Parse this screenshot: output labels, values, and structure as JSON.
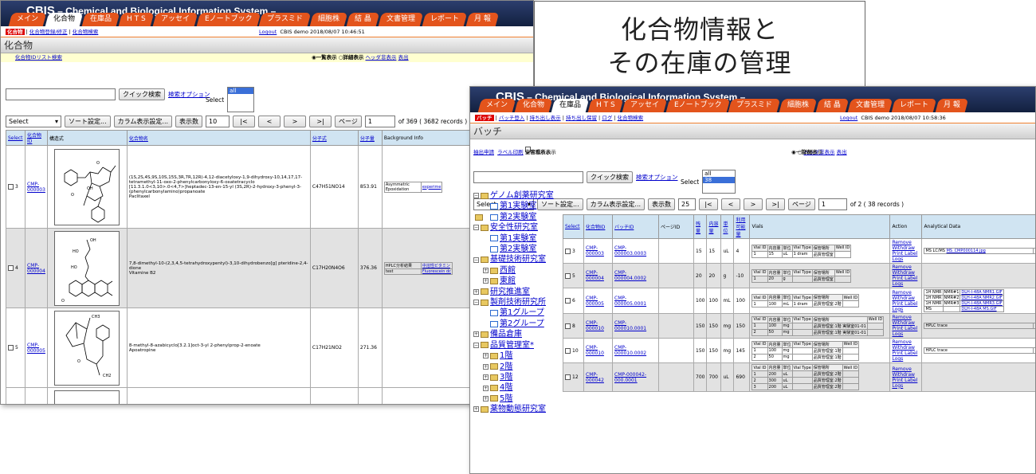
{
  "app": {
    "brand_bold": "CBIS",
    "brand_rest": " – Chemical and Biological Information System –"
  },
  "tabs": [
    "メイン",
    "化合物",
    "在庫品",
    "H T S",
    "アッセイ",
    "Eノートブック",
    "プラスミド",
    "細胞株",
    "結 晶",
    "文書管理",
    "レポート",
    "月 報"
  ],
  "w1": {
    "sub": {
      "current": "化合物",
      "links": [
        "化合物登録/修正",
        "化合物検索"
      ],
      "logout": "Logout",
      "user": "CBIS demo  2018/08/07 10:46:51"
    },
    "page_title": "化合物",
    "list_link": "化合物IDリスト検索",
    "radio_list": "一覧表示",
    "radio_detail": "詳細表示",
    "hide_header": "ヘッダ非表示",
    "output": "表出",
    "quick_search": "クイック検索",
    "search_option": "検索オプション",
    "select_label": "Select",
    "select_option": "all",
    "select_box": "Select",
    "sort": "ソート設定...",
    "column": "カラム表示設定...",
    "count_label": "表示数",
    "count": "10",
    "nav": [
      "|<",
      "<",
      ">",
      ">|"
    ],
    "page_label": "ページ",
    "page": "1",
    "records": "of 369 ( 3682 records )",
    "headers": [
      "Select",
      "化合物ID",
      "構造式",
      "化合物名",
      "分子式",
      "分子量",
      "Background Info"
    ],
    "rows": [
      {
        "n": "3",
        "id": "CMP-000003",
        "name": "(1S,2S,4S,9S,10S,15S,3R,7R,12R)-4,12-diacetyloxy-1,9-dihydroxy-10,14,17,17-tetramethyl-11-oxo-2-phenylcarbonyloxy-6-oxatetracyclo [11.3.1.0<3,10>.0<4,7>]heptadec-13-en-15-yl (3S,2R)-2-hydroxy-3-phenyl-3-(phenylcarbonylamino)propanoate\nPaclitaxel",
        "formula": "C47H51NO14",
        "mw": "853.91",
        "bg1": "Asymmetric Epoxidation",
        "bg2": "experime"
      },
      {
        "n": "4",
        "id": "CMP-000004",
        "name": "7,8-dimethyl-10-(2,3,4,5-tetrahydroxypentyl)-3,10-dihydrobenzo[g] pteridine-2,4-dione\nVitamine B2",
        "formula": "C17H20N4O6",
        "mw": "376.36",
        "bg1": "HPLC分析結果",
        "bg2": "中溶性ビタミン",
        "bg3": "test",
        "bg4": "Fluorescein dc"
      },
      {
        "n": "5",
        "id": "CMP-000005",
        "name": "8-methyl-8-azabicyclo[3.2.1]oct-3-yl 2-phenylprop-2-enoate\nApoatropine",
        "formula": "C17H21NO2",
        "mw": "271.36"
      }
    ]
  },
  "callout": {
    "line1": "化合物情報と",
    "line2": "その在庫の管理"
  },
  "w2": {
    "sub": {
      "current": "バッチ",
      "links": [
        "バッチ登入",
        "持ち出し表示",
        "持ち出し保留",
        "ログ",
        "化合物検索"
      ],
      "logout": "Logout",
      "user": "CBIS demo  2018/08/07 10:58:36"
    },
    "page_title": "バッチ",
    "bar_links": [
      "抽出申請",
      "ラベル印刷"
    ],
    "chk1": "保管場所表示",
    "chk2": "空容器表示",
    "radio_list": "一覧表示",
    "radio_detail": "詳細表示",
    "hide_header": "ヘッダ非表示",
    "output": "表出",
    "quick_search": "クイック検索",
    "search_option": "検索オプション",
    "select_label": "Select",
    "select_options": [
      "all",
      "38"
    ],
    "select_box": "Select",
    "sort": "ソート設定...",
    "column": "カラム表示設定...",
    "count_label": "表示数",
    "count": "25",
    "nav": [
      "|<",
      "<",
      ">",
      ">|"
    ],
    "page_label": "ページ",
    "page": "1",
    "records": "of 2 ( 38 records )",
    "tree": [
      {
        "t": "ゲノム創薬研究室",
        "d": 0,
        "pm": "⊟",
        "type": "folder"
      },
      {
        "t": "第1実験室",
        "d": 1,
        "type": "doc"
      },
      {
        "t": "第2実験室",
        "d": 1,
        "type": "doc"
      },
      {
        "t": "安全性研究室",
        "d": 0,
        "pm": "⊟",
        "type": "folder"
      },
      {
        "t": "第1実験室",
        "d": 1,
        "type": "doc"
      },
      {
        "t": "第2実験室",
        "d": 1,
        "type": "doc"
      },
      {
        "t": "基礎技術研究室",
        "d": 0,
        "pm": "⊟",
        "type": "folder"
      },
      {
        "t": "西館",
        "d": 1,
        "pm": "⊞",
        "type": "folder"
      },
      {
        "t": "東館",
        "d": 1,
        "pm": "⊞",
        "type": "folder"
      },
      {
        "t": "研究推進室",
        "d": 0,
        "pm": "⊞",
        "type": "folder"
      },
      {
        "t": "製剤技術研究所",
        "d": 0,
        "pm": "⊟",
        "type": "folder"
      },
      {
        "t": "第1グループ",
        "d": 1,
        "type": "doc"
      },
      {
        "t": "第2グループ",
        "d": 1,
        "type": "doc"
      },
      {
        "t": "備品倉庫",
        "d": 0,
        "pm": "⊞",
        "type": "folder"
      },
      {
        "t": "品質管理室*",
        "d": 0,
        "pm": "⊟",
        "type": "folder"
      },
      {
        "t": "1階",
        "d": 1,
        "pm": "⊞",
        "type": "folder"
      },
      {
        "t": "2階",
        "d": 1,
        "pm": "⊞",
        "type": "folder"
      },
      {
        "t": "3階",
        "d": 1,
        "pm": "⊞",
        "type": "folder"
      },
      {
        "t": "4階",
        "d": 1,
        "pm": "⊞",
        "type": "folder"
      },
      {
        "t": "5階",
        "d": 1,
        "pm": "⊞",
        "type": "folder"
      },
      {
        "t": "薬物動態研究室",
        "d": 0,
        "pm": "⊞",
        "type": "folder"
      }
    ],
    "headers": [
      "Select",
      "化合物ID",
      "バッチID",
      "ページID",
      "残量",
      "内容量",
      "単位",
      "利用可能量",
      "Vials",
      "Action",
      "Analytical Data"
    ],
    "vial_headers": [
      "Vial ID",
      "内容量",
      "単位",
      "Vial Type",
      "保管場所",
      "Well ID"
    ],
    "actions": [
      "Remove",
      "Withdraw",
      "Print Label",
      "Logs"
    ],
    "rows": [
      {
        "n": "3",
        "cid": "CMP-000003",
        "bid": "CMP-000003.0003",
        "rem": "15",
        "cont": "15",
        "unit": "uL",
        "avail": "4",
        "vials": [
          [
            "1",
            "15",
            "uL",
            "1 dram",
            "品質管理室",
            ""
          ]
        ],
        "ad": "MS LC/MS",
        "ad_link": "MS_CMP000114.jpg"
      },
      {
        "n": "5",
        "cid": "CMP-000004",
        "bid": "CMP-000004.0002",
        "rem": "20",
        "cont": "20",
        "unit": "g",
        "avail": "-10",
        "vials": [
          [
            "1",
            "20",
            "g",
            "",
            "品質管理室",
            ""
          ]
        ]
      },
      {
        "n": "6",
        "cid": "CMP-000005",
        "bid": "CMP-000005.0001",
        "rem": "100",
        "cont": "100",
        "unit": "mL",
        "avail": "100",
        "vials": [
          [
            "1",
            "100",
            "mL",
            "1 dram",
            "品質管理室:2階",
            ""
          ]
        ],
        "nmr": [
          [
            "1H NMR",
            "NMR#1",
            "DLH-I-48A NMR1.GIF"
          ],
          [
            "1H NMR",
            "NMR#2",
            "DLH-I-48A NMR2.GIF"
          ],
          [
            "1H NMR",
            "NMR#3",
            "DLH-I-48A NMR3.GIF"
          ],
          [
            "MS",
            "",
            "DLH-I-48A MS.GIF"
          ]
        ]
      },
      {
        "n": "8",
        "cid": "CMP-000010",
        "bid": "CMP-000010.0001",
        "rem": "150",
        "cont": "150",
        "unit": "mg",
        "avail": "150",
        "vials": [
          [
            "1",
            "100",
            "mg",
            "",
            "品質管理室:1階 実験室01-01",
            ""
          ],
          [
            "2",
            "50",
            "mg",
            "",
            "品質管理室:1階 実験室01-01",
            ""
          ]
        ],
        "ad": "HPLC trace"
      },
      {
        "n": "10",
        "cid": "CMP-000010",
        "bid": "CMP-000010.0002",
        "rem": "150",
        "cont": "150",
        "unit": "mg",
        "avail": "145",
        "vials": [
          [
            "1",
            "100",
            "mg",
            "",
            "品質管理室:1階",
            ""
          ],
          [
            "2",
            "50",
            "mg",
            "",
            "品質管理室:1階",
            ""
          ]
        ],
        "ad": "HPLC trace"
      },
      {
        "n": "12",
        "cid": "CMP-000042",
        "bid": "CMP-000042-000.0001",
        "rem": "700",
        "cont": "700",
        "unit": "uL",
        "avail": "690",
        "vials": [
          [
            "1",
            "200",
            "uL",
            "",
            "品質管理室:2階",
            ""
          ],
          [
            "2",
            "300",
            "uL",
            "",
            "品質管理室:2階",
            ""
          ],
          [
            "3",
            "200",
            "uL",
            "",
            "品質管理室:2階",
            ""
          ]
        ]
      }
    ]
  }
}
